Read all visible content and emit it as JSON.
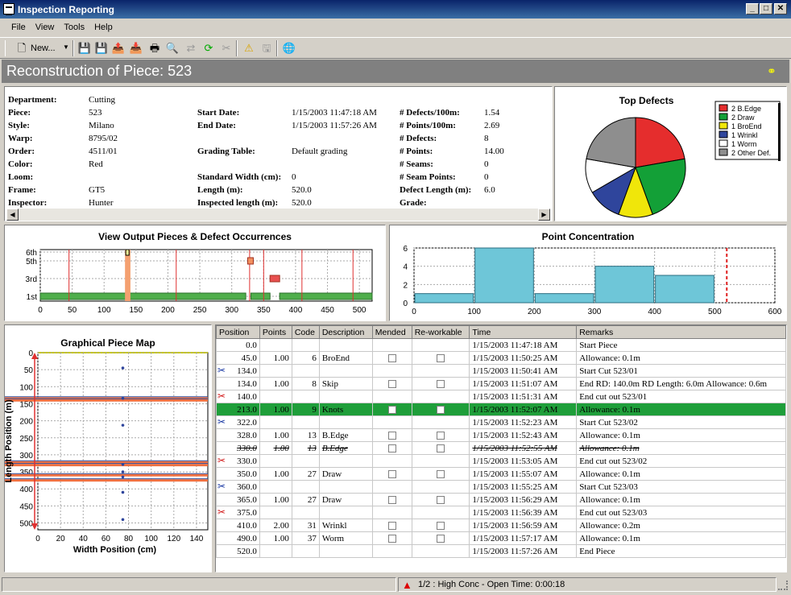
{
  "window": {
    "title": "Inspection Reporting",
    "min": "_",
    "max": "□",
    "close": "✕"
  },
  "menu": [
    "File",
    "View",
    "Tools",
    "Help"
  ],
  "toolbar": {
    "new_label": "New..."
  },
  "header": {
    "title": "Reconstruction of Piece: 523"
  },
  "info": {
    "col1": [
      {
        "label": "Department:",
        "value": "Cutting"
      },
      {
        "label": "Piece:",
        "value": "523"
      },
      {
        "label": "Style:",
        "value": "Milano"
      },
      {
        "label": "Warp:",
        "value": "8795/02"
      },
      {
        "label": "Order:",
        "value": "4511/01"
      },
      {
        "label": "Color:",
        "value": "Red"
      },
      {
        "label": "Loom:",
        "value": ""
      },
      {
        "label": "Frame:",
        "value": "GT5"
      },
      {
        "label": "Inspector:",
        "value": "Hunter"
      }
    ],
    "col2": [
      {
        "label": "Start Date:",
        "value": "1/15/2003 11:47:18 AM"
      },
      {
        "label": "End Date:",
        "value": "1/15/2003 11:57:26 AM"
      },
      {
        "label": "",
        "value": ""
      },
      {
        "label": "Grading Table:",
        "value": "Default grading"
      },
      {
        "label": "",
        "value": ""
      },
      {
        "label": "Standard Width (cm):",
        "value": "0"
      },
      {
        "label": "Length (m):",
        "value": "520.0"
      },
      {
        "label": "Inspected length (m):",
        "value": "520.0"
      }
    ],
    "col3": [
      {
        "label": "# Defects/100m:",
        "value": "1.54"
      },
      {
        "label": "# Points/100m:",
        "value": "2.69"
      },
      {
        "label": "# Defects:",
        "value": "8"
      },
      {
        "label": "# Points:",
        "value": "14.00"
      },
      {
        "label": "# Seams:",
        "value": "0"
      },
      {
        "label": "# Seam Points:",
        "value": "0"
      },
      {
        "label": "Defect Length (m):",
        "value": "6.0"
      },
      {
        "label": "Grade:",
        "value": ""
      }
    ]
  },
  "colors": {
    "red": "#e52d2d",
    "green": "#13a037",
    "yellow": "#f0e60a",
    "blue": "#2f459c",
    "white": "#ffffff",
    "gray": "#8e8e8e",
    "bar": "#6ec6d8",
    "selected": "#1f9e3a"
  },
  "chart_data": [
    {
      "type": "pie",
      "title": "Top Defects",
      "legend": "top-right",
      "labels": [
        "2 B.Edge",
        "2 Draw",
        "1 BroEnd",
        "1 Wrinkl",
        "1 Worm",
        "2 Other Def."
      ],
      "values": [
        2,
        2,
        1,
        1,
        1,
        2
      ],
      "colors": [
        "#e52d2d",
        "#13a037",
        "#f0e60a",
        "#2f459c",
        "#ffffff",
        "#8e8e8e"
      ]
    },
    {
      "type": "bar",
      "title": "View Output Pieces & Defect Occurrences",
      "xlim": [
        0,
        520
      ],
      "xticks": [
        0,
        50,
        100,
        150,
        200,
        250,
        300,
        350,
        400,
        450,
        500
      ],
      "ytick_labels": [
        "1st",
        "3rd",
        "5th",
        "6th"
      ],
      "pieces": [
        [
          0,
          134
        ],
        [
          140,
          322
        ],
        [
          330,
          360
        ],
        [
          375,
          520
        ]
      ],
      "defect_lines": [
        45,
        134,
        213,
        328,
        350,
        410,
        490
      ],
      "markers": [
        {
          "x": 330,
          "level": "5th"
        },
        {
          "x": 365,
          "level": "3rd"
        }
      ]
    },
    {
      "type": "bar",
      "title": "Point Concentration",
      "xlim": [
        0,
        600
      ],
      "ylim": [
        0,
        6
      ],
      "xticks": [
        0,
        100,
        200,
        300,
        400,
        500,
        600
      ],
      "yticks": [
        0,
        2,
        4,
        6
      ],
      "bars": [
        [
          0,
          100,
          1
        ],
        [
          100,
          200,
          6
        ],
        [
          200,
          300,
          1
        ],
        [
          300,
          400,
          4
        ],
        [
          400,
          500,
          3
        ]
      ],
      "threshold": 520
    },
    {
      "type": "scatter",
      "title": "Graphical Piece Map",
      "xlabel": "Width Position (cm)",
      "ylabel": "Length Position (m)",
      "xlim": [
        0,
        150
      ],
      "ylim": [
        0,
        520
      ],
      "xticks": [
        0,
        20,
        40,
        60,
        80,
        100,
        120,
        140
      ],
      "yticks": [
        0,
        50,
        100,
        150,
        200,
        250,
        300,
        350,
        400,
        450,
        500
      ],
      "points": [
        [
          75,
          45
        ],
        [
          75,
          134
        ],
        [
          75,
          213
        ],
        [
          75,
          328
        ],
        [
          75,
          350
        ],
        [
          75,
          365
        ],
        [
          75,
          410
        ],
        [
          75,
          490
        ]
      ],
      "bands": [
        134,
        140,
        322,
        330,
        360,
        375
      ]
    }
  ],
  "table": {
    "headers": [
      "Position",
      "Points",
      "Code",
      "Description",
      "Mended",
      "Re-workable",
      "Time",
      "Remarks"
    ],
    "rows": [
      {
        "icon": "",
        "pos": "0.0",
        "pts": "",
        "code": "",
        "desc": "",
        "chk": false,
        "time": "1/15/2003 11:47:18 AM",
        "rem": "Start Piece"
      },
      {
        "icon": "",
        "pos": "45.0",
        "pts": "1.00",
        "code": "6",
        "desc": "BroEnd",
        "chk": true,
        "time": "1/15/2003 11:50:25 AM",
        "rem": " Allowance: 0.1m"
      },
      {
        "icon": "blue",
        "pos": "134.0",
        "pts": "",
        "code": "",
        "desc": "",
        "chk": false,
        "time": "1/15/2003 11:50:41 AM",
        "rem": "Start Cut 523/01"
      },
      {
        "icon": "",
        "pos": "134.0",
        "pts": "1.00",
        "code": "8",
        "desc": "Skip",
        "chk": true,
        "time": "1/15/2003 11:51:07 AM",
        "rem": "End RD: 140.0m  RD Length: 6.0m Allowance: 0.6m"
      },
      {
        "icon": "red",
        "pos": "140.0",
        "pts": "",
        "code": "",
        "desc": "",
        "chk": false,
        "time": "1/15/2003 11:51:31 AM",
        "rem": "End cut out 523/01"
      },
      {
        "icon": "",
        "pos": "213.0",
        "pts": "1.00",
        "code": "9",
        "desc": "Knots",
        "chk": true,
        "time": "1/15/2003 11:52:07 AM",
        "rem": " Allowance: 0.1m",
        "sel": true
      },
      {
        "icon": "blue",
        "pos": "322.0",
        "pts": "",
        "code": "",
        "desc": "",
        "chk": false,
        "time": "1/15/2003 11:52:23 AM",
        "rem": "Start Cut 523/02"
      },
      {
        "icon": "",
        "pos": "328.0",
        "pts": "1.00",
        "code": "13",
        "desc": "B.Edge",
        "chk": true,
        "time": "1/15/2003 11:52:43 AM",
        "rem": " Allowance: 0.1m"
      },
      {
        "icon": "",
        "pos": "330.0",
        "pts": "1.00",
        "code": "13",
        "desc": "B.Edge",
        "chk": true,
        "time": "1/15/2003 11:52:55 AM",
        "rem": " Allowance: 0.1m",
        "strike": true
      },
      {
        "icon": "red",
        "pos": "330.0",
        "pts": "",
        "code": "",
        "desc": "",
        "chk": false,
        "time": "1/15/2003 11:53:05 AM",
        "rem": "End cut out 523/02"
      },
      {
        "icon": "",
        "pos": "350.0",
        "pts": "1.00",
        "code": "27",
        "desc": "Draw",
        "chk": true,
        "time": "1/15/2003 11:55:07 AM",
        "rem": " Allowance: 0.1m"
      },
      {
        "icon": "blue",
        "pos": "360.0",
        "pts": "",
        "code": "",
        "desc": "",
        "chk": false,
        "time": "1/15/2003 11:55:25 AM",
        "rem": "Start Cut 523/03"
      },
      {
        "icon": "",
        "pos": "365.0",
        "pts": "1.00",
        "code": "27",
        "desc": "Draw",
        "chk": true,
        "time": "1/15/2003 11:56:29 AM",
        "rem": " Allowance: 0.1m"
      },
      {
        "icon": "red",
        "pos": "375.0",
        "pts": "",
        "code": "",
        "desc": "",
        "chk": false,
        "time": "1/15/2003 11:56:39 AM",
        "rem": "End cut out 523/03"
      },
      {
        "icon": "",
        "pos": "410.0",
        "pts": "2.00",
        "code": "31",
        "desc": "Wrinkl",
        "chk": true,
        "time": "1/15/2003 11:56:59 AM",
        "rem": " Allowance: 0.2m"
      },
      {
        "icon": "",
        "pos": "490.0",
        "pts": "1.00",
        "code": "37",
        "desc": "Worm",
        "chk": true,
        "time": "1/15/2003 11:57:17 AM",
        "rem": " Allowance: 0.1m"
      },
      {
        "icon": "",
        "pos": "520.0",
        "pts": "",
        "code": "",
        "desc": "",
        "chk": false,
        "time": "1/15/2003 11:57:26 AM",
        "rem": "End Piece"
      }
    ]
  },
  "status": {
    "text": "1/2 : High Conc - Open Time: 0:00:18"
  }
}
